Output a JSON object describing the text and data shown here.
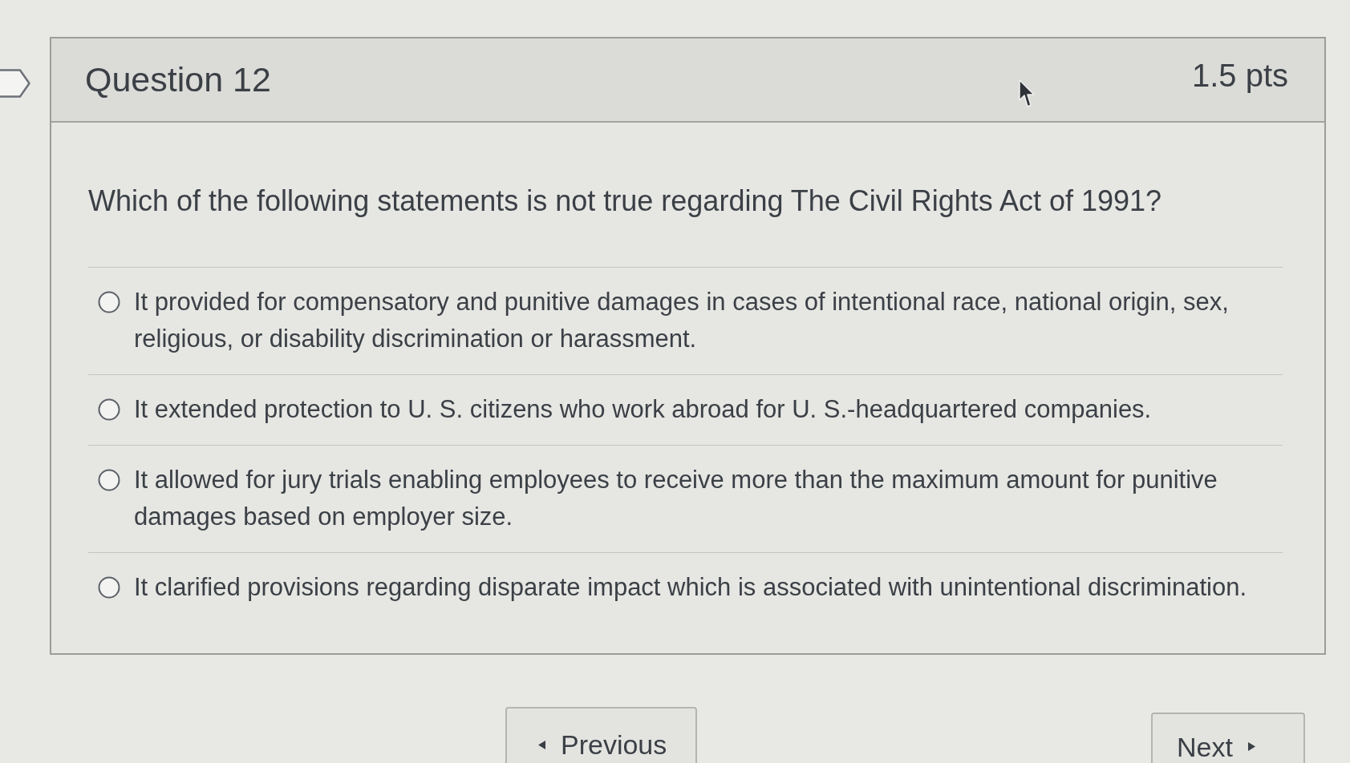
{
  "question": {
    "title": "Question 12",
    "points": "1.5 pts",
    "text": "Which of the following statements is not true regarding The Civil Rights Act of 1991?",
    "answers": [
      {
        "label": "It provided for compensatory and punitive damages in cases of intentional race, national origin, sex, religious, or disability discrimination or harassment.",
        "selected": false
      },
      {
        "label": "It extended protection to U. S. citizens who work abroad for U. S.-headquartered companies.",
        "selected": false
      },
      {
        "label": "It allowed for jury trials enabling employees to receive more than the maximum amount for punitive damages based on employer size.",
        "selected": false
      },
      {
        "label": "It clarified provisions regarding disparate impact which is associated with unintentional discrimination.",
        "selected": false
      }
    ]
  },
  "navigation": {
    "previous": "Previous",
    "next": "Next"
  }
}
